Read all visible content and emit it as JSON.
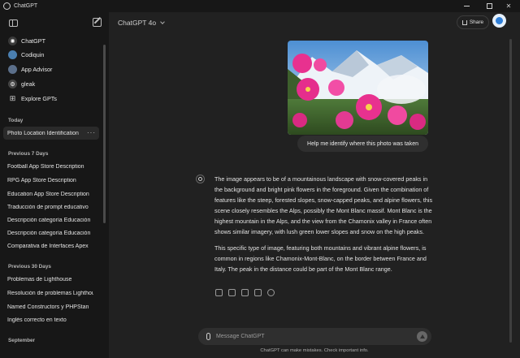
{
  "window": {
    "title": "ChatGPT"
  },
  "sidebar": {
    "gpts": [
      {
        "label": "ChatGPT",
        "icon": "chatgpt-logo-icon",
        "color": "#3a3a3a"
      },
      {
        "label": "Codiquin",
        "icon": "codiquin-avatar-icon",
        "color": "#4a7fb0"
      },
      {
        "label": "App Advisor",
        "icon": "app-advisor-avatar-icon",
        "color": "#5b6f8a"
      },
      {
        "label": "gleak",
        "icon": "gleak-avatar-icon",
        "color": "#444444"
      },
      {
        "label": "Explore GPTs",
        "icon": "grid-icon",
        "color": "#171717"
      }
    ],
    "sections": [
      {
        "title": "Today",
        "items": [
          "Photo Location Identification"
        ]
      },
      {
        "title": "Previous 7 Days",
        "items": [
          "Football App Store Description",
          "RPG App Store Description",
          "Education App Store Description",
          "Traducción de prompt educativo",
          "Descripción categoría Educación",
          "Descripción categoría Educación",
          "Comparativa de Interfaces Apex"
        ]
      },
      {
        "title": "Previous 30 Days",
        "items": [
          "Problemas de Lighthouse",
          "Resolución de problemas Lighthouse",
          "Named Constructors y PHPStan",
          "Inglés correcto en texto"
        ]
      },
      {
        "title": "September",
        "items": []
      }
    ]
  },
  "header": {
    "model": "ChatGPT 4o",
    "share_label": "Share"
  },
  "conversation": {
    "user_message": "Help me identify where this photo was taken",
    "answer_paragraphs": [
      "The image appears to be of a mountainous landscape with snow-covered peaks in the background and bright pink flowers in the foreground. Given the combination of features like the steep, forested slopes, snow-capped peaks, and alpine flowers, this scene closely resembles the Alps, possibly the Mont Blanc massif. Mont Blanc is the highest mountain in the Alps, and the view from the Chamonix valley in France often shows similar imagery, with lush green lower slopes and snow on the high peaks.",
      "This specific type of image, featuring both mountains and vibrant alpine flowers, is common in regions like Chamonix-Mont-Blanc, on the border between France and Italy. The peak in the distance could be part of the Mont Blanc range."
    ]
  },
  "composer": {
    "placeholder": "Message ChatGPT"
  },
  "footer": {
    "disclaimer": "ChatGPT can make mistakes. Check important info."
  }
}
